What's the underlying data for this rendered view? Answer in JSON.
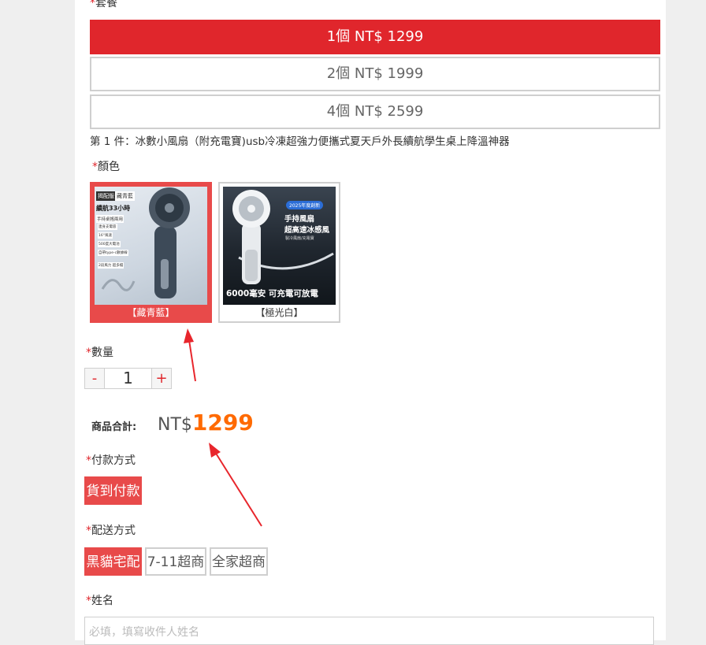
{
  "package": {
    "label": "套餐",
    "options": [
      "1個 NT$ 1299",
      "2個 NT$ 1999",
      "4個 NT$ 2599"
    ],
    "selected_index": 0
  },
  "product_desc": "第 1 件：冰數小風扇（附充電寶)usb冷凍超強力便攜式夏天戶外長續航學生桌上降溫神器",
  "color": {
    "label": "顏色",
    "swatches": [
      {
        "caption": "【藏青藍】",
        "img_text": [
          "揭配版",
          "藏青藍",
          "續航33小時",
          "手持桌搖兩用",
          "連身支電容",
          "16°風速",
          "500度大電池",
          "自帶type-c數據線",
          "2段風力 超多檔"
        ]
      },
      {
        "caption": "【極光白】",
        "img_text": [
          "2025年度創新",
          "手持風扇",
          "超高速冰感風",
          "製冷風扇/充電寶",
          "6000毫安 可充電可放電"
        ]
      }
    ],
    "selected_index": 0
  },
  "quantity": {
    "label": "數量",
    "minus": "-",
    "value": "1",
    "plus": "+"
  },
  "total": {
    "label": "商品合計:",
    "currency": "NT$",
    "amount": "1299"
  },
  "payment": {
    "label": "付款方式",
    "options": [
      "貨到付款"
    ]
  },
  "shipping": {
    "label": "配送方式",
    "options": [
      "黑貓宅配",
      "7-11超商",
      "全家超商"
    ]
  },
  "name": {
    "label": "姓名",
    "placeholder": "必填，填寫收件人姓名"
  },
  "required_mark": "*",
  "colors": {
    "accent": "#e0262c",
    "swatch_selected": "#e84a4a",
    "price": "#ff6a00",
    "annotation_arrow": "#e8262c"
  }
}
